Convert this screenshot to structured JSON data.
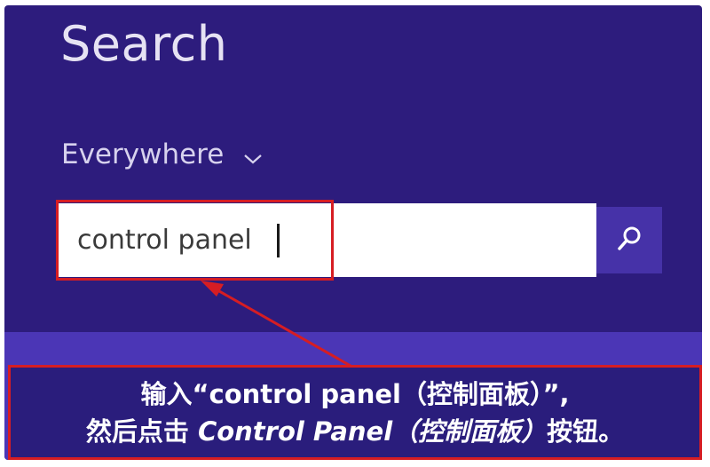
{
  "header": {
    "title": "Search"
  },
  "scope": {
    "label": "Everywhere",
    "chevron_icon": "chevron-down-icon"
  },
  "search": {
    "value": "control panel",
    "button_icon": "search-icon"
  },
  "annotation": {
    "line1": "输入“control panel（控制面板）”,",
    "line2_prefix": "然后点击 ",
    "line2_emphasis": "Control Panel（控制面板）",
    "line2_suffix": "按钮。"
  },
  "colors": {
    "background": "#2d1c7d",
    "search_button": "#4632a8",
    "highlight": "#d61d23",
    "results_band": "#4b36b6"
  }
}
